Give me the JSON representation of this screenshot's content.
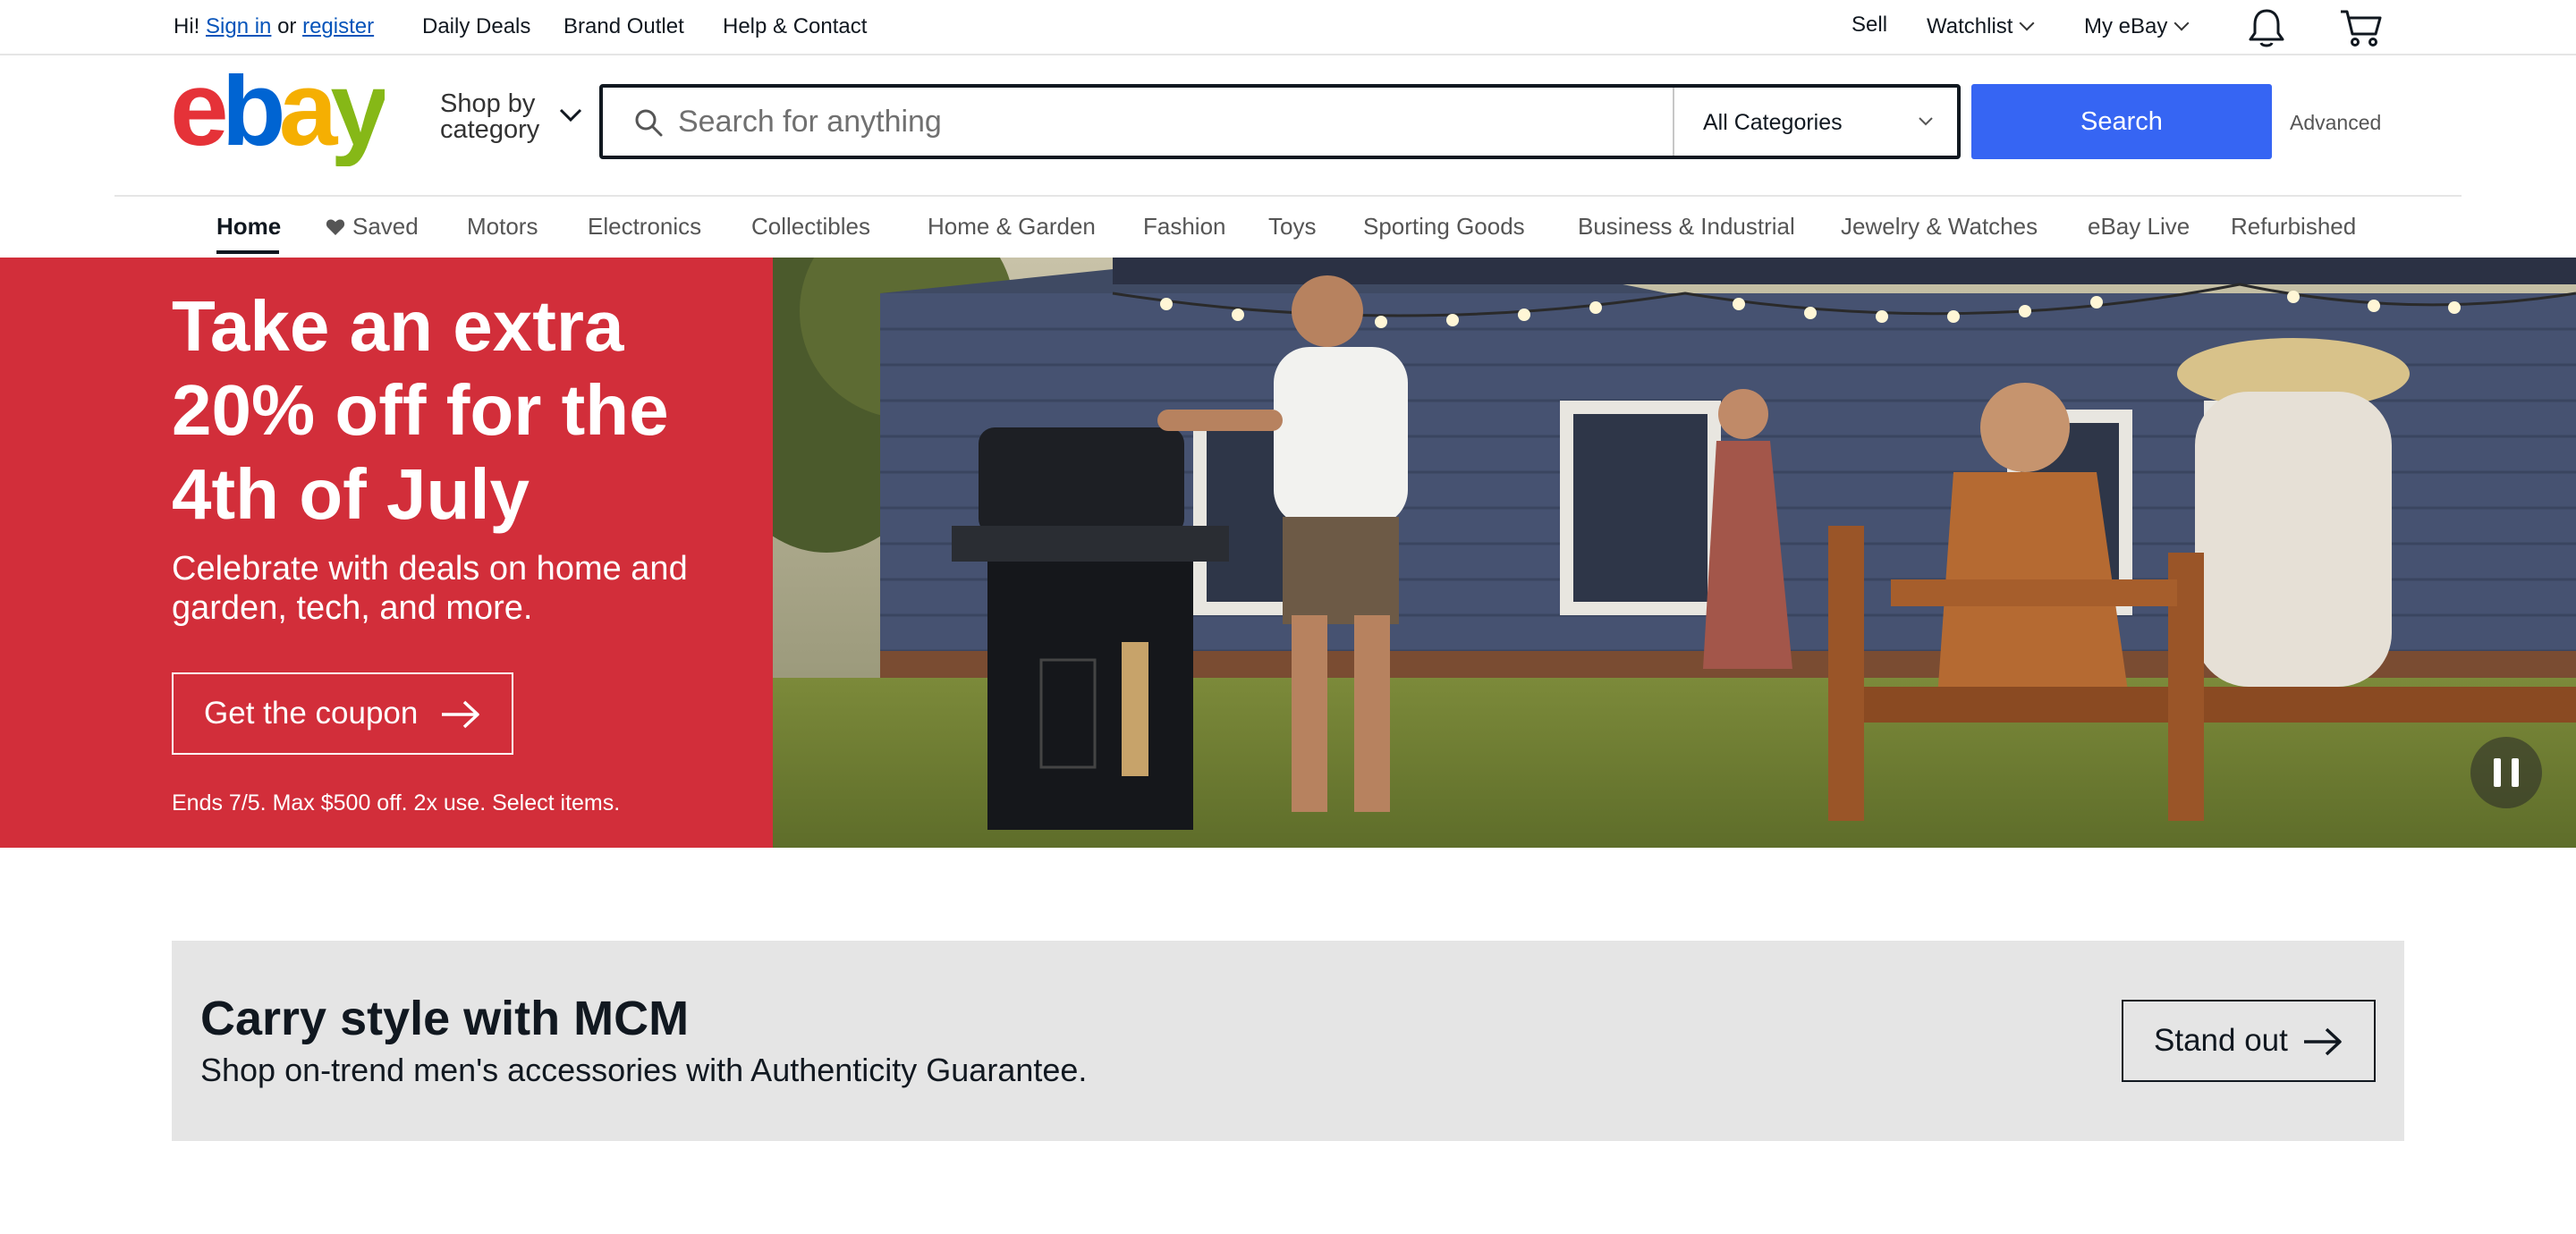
{
  "topbar": {
    "greeting": "Hi!",
    "sign_in": "Sign in",
    "or": "or",
    "register": "register",
    "daily_deals": "Daily Deals",
    "brand_outlet": "Brand Outlet",
    "help_contact": "Help & Contact",
    "sell": "Sell",
    "watchlist": "Watchlist",
    "my_ebay": "My eBay",
    "notification_icon": "bell-icon",
    "cart_icon": "cart-icon"
  },
  "header": {
    "logo_text": "ebay",
    "logo_colors": [
      "#e53238",
      "#0064d2",
      "#f5af02",
      "#86b817"
    ],
    "shop_by_category": "Shop by\ncategory",
    "search": {
      "placeholder": "Search for anything",
      "category_selected": "All Categories",
      "button": "Search",
      "advanced": "Advanced"
    },
    "accent_color": "#3665f3"
  },
  "category_nav": {
    "items": [
      {
        "label": "Home",
        "active": true
      },
      {
        "label": "Saved",
        "icon": "heart-icon"
      },
      {
        "label": "Motors"
      },
      {
        "label": "Electronics"
      },
      {
        "label": "Collectibles"
      },
      {
        "label": "Home & Garden"
      },
      {
        "label": "Fashion"
      },
      {
        "label": "Toys"
      },
      {
        "label": "Sporting Goods"
      },
      {
        "label": "Business & Industrial"
      },
      {
        "label": "Jewelry & Watches"
      },
      {
        "label": "eBay Live"
      },
      {
        "label": "Refurbished"
      }
    ]
  },
  "hero": {
    "background_color": "#d22e3a",
    "title": "Take an extra 20% off for the 4th of July",
    "subtitle": "Celebrate with deals on home and garden, tech, and more.",
    "cta": "Get the coupon",
    "terms": "Ends 7/5. Max $500 off. 2x use. Select items.",
    "pause_icon": "pause-icon"
  },
  "promo": {
    "title": "Carry style with MCM",
    "subtitle": "Shop on-trend men's accessories with Authenticity Guarantee.",
    "cta": "Stand out",
    "background_color": "#e5e5e5"
  }
}
